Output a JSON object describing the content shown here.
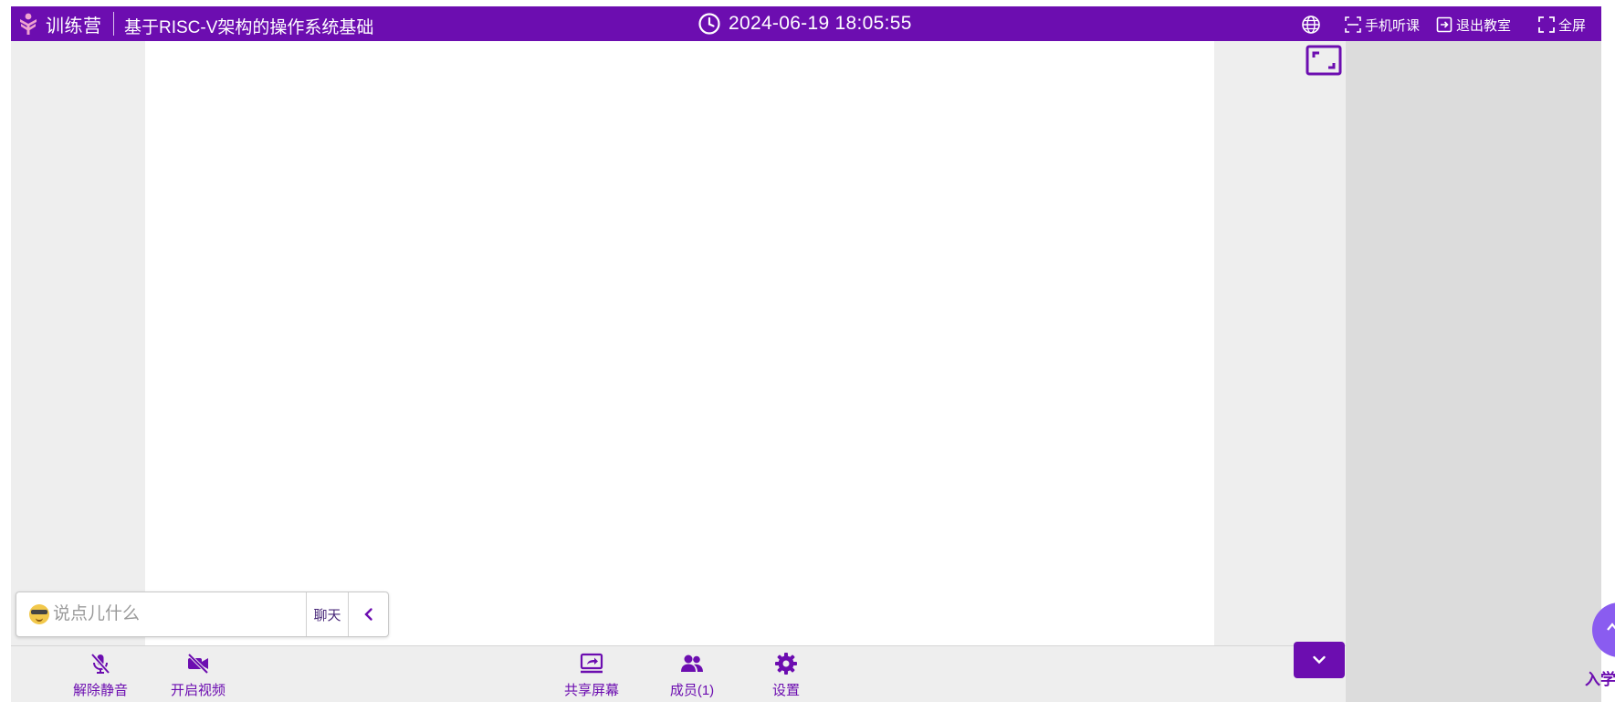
{
  "header": {
    "brand_name": "训练营",
    "course_title": "基于RISC-V架构的操作系统基础",
    "datetime": "2024-06-19 18:05:55",
    "actions": {
      "mobile_label": "手机听课",
      "exit_label": "退出教室",
      "fullscreen_label": "全屏"
    }
  },
  "chat": {
    "placeholder": "说点儿什么",
    "tab_label": "聊天"
  },
  "toolbar": {
    "unmute_label": "解除静音",
    "video_label": "开启视频",
    "share_label": "共享屏幕",
    "members_label": "成员(1)",
    "settings_label": "设置"
  },
  "floating": {
    "label": "入学"
  },
  "colors": {
    "brand": "#6c0db0",
    "stage": "#ffffff",
    "panel": "#dcdcdc",
    "background": "#eeeeee"
  },
  "icons": {
    "logo": "brand-logo",
    "clock": "clock-icon",
    "globe": "globe-icon",
    "mobile": "scan-icon",
    "exit": "exit-icon",
    "fullscreen": "fullscreen-icon",
    "expand": "expand-icon",
    "collapse": "chevron-left-icon",
    "mute": "mic-off-icon",
    "video": "video-off-icon",
    "share": "screen-share-icon",
    "members": "users-icon",
    "settings": "gear-icon",
    "dropdown": "chevron-down-icon"
  }
}
